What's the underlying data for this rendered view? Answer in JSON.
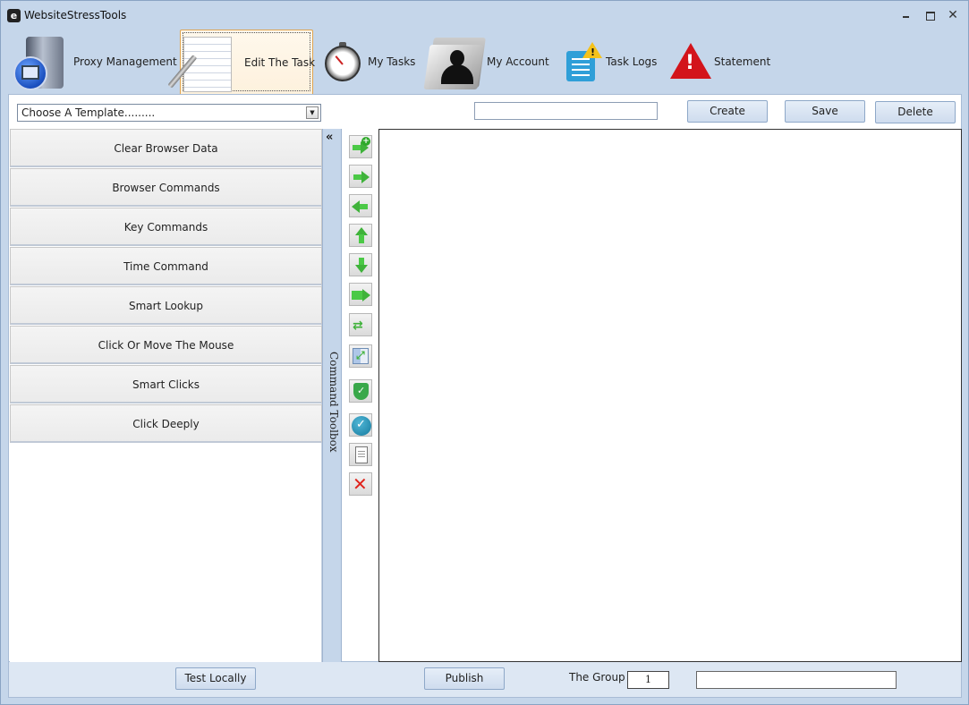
{
  "window": {
    "title": "WebsiteStressTools",
    "app_icon_glyph": "e"
  },
  "nav": [
    {
      "label": "Proxy Management",
      "icon": "server-globe-icon"
    },
    {
      "label": "Edit The Task",
      "icon": "notepad-pen-icon",
      "active": true
    },
    {
      "label": "My Tasks",
      "icon": "stopwatch-icon"
    },
    {
      "label": "My Account",
      "icon": "user-folder-icon"
    },
    {
      "label": "Task Logs",
      "icon": "log-warning-icon"
    },
    {
      "label": "Statement",
      "icon": "alert-triangle-icon"
    }
  ],
  "toolbar": {
    "template_placeholder": "Choose A Template.........",
    "task_name_value": "",
    "create_label": "Create",
    "save_label": "Save",
    "delete_label": "Delete"
  },
  "commands": [
    "Clear Browser Data",
    "Browser Commands",
    "Key Commands",
    "Time Command",
    "Smart Lookup",
    "Click Or Move The Mouse",
    "Smart Clicks",
    "Click Deeply"
  ],
  "toolbox": {
    "label": "Command Toolbox",
    "collapse_glyph": "«"
  },
  "actions": [
    "add-command-icon",
    "move-right-icon",
    "move-left-icon",
    "move-up-icon",
    "move-down-icon",
    "indent-icon",
    "shuffle-icon",
    "swap-columns-icon",
    "shield-check-icon",
    "verify-check-icon",
    "copy-document-icon",
    "delete-x-icon"
  ],
  "bottom": {
    "test_label": "Test Locally",
    "publish_label": "Publish",
    "group_label": "The Group",
    "group_value": "1",
    "extra_value": ""
  }
}
